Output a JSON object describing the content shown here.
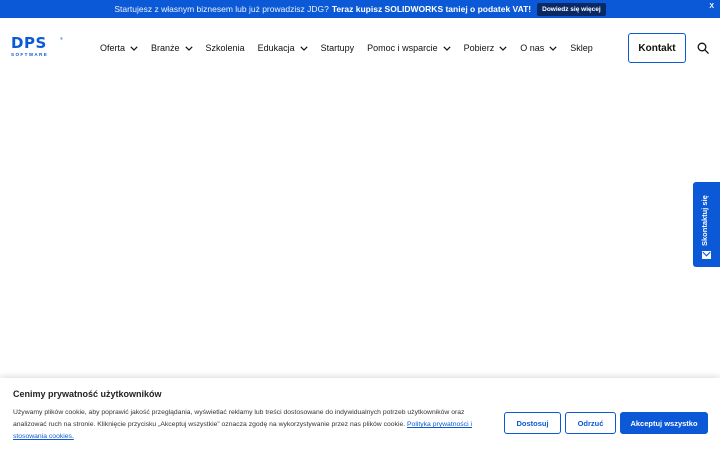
{
  "colors": {
    "brand": "#0b59d6",
    "promo_button": "#0a2a66",
    "text": "#111111"
  },
  "promo": {
    "text": "Startujesz z własnym biznesem lub już prowadzisz JDG?",
    "highlight": "Teraz kupisz SOLIDWORKS taniej o podatek VAT!",
    "button": "Dowiedz się więcej",
    "close": "X"
  },
  "logo": {
    "main": "DPS",
    "sub": "SOFTWARE",
    "reg": "®"
  },
  "nav": {
    "items": [
      {
        "label": "Oferta",
        "has_dropdown": true
      },
      {
        "label": "Branże",
        "has_dropdown": true
      },
      {
        "label": "Szkolenia",
        "has_dropdown": false
      },
      {
        "label": "Edukacja",
        "has_dropdown": true
      },
      {
        "label": "Startupy",
        "has_dropdown": false
      },
      {
        "label": "Pomoc i wsparcie",
        "has_dropdown": true
      },
      {
        "label": "Pobierz",
        "has_dropdown": true
      },
      {
        "label": "O nas",
        "has_dropdown": true
      },
      {
        "label": "Sklep",
        "has_dropdown": false
      }
    ],
    "contact": "Kontakt",
    "search_icon": "search-icon"
  },
  "side_tab": {
    "label": "Skontaktuj się",
    "icon": "mail-icon"
  },
  "cookie": {
    "title": "Cenimy prywatność użytkowników",
    "text": "Używamy plików cookie, aby poprawić jakość przeglądania, wyświetlać reklamy lub treści dostosowane do indywidualnych potrzeb użytkowników oraz analizować ruch na stronie. Kliknięcie przycisku „Akceptuj wszystkie” oznacza zgodę na wykorzystywanie przez nas plików cookie.",
    "link": "Polityka prywatności i stosowania cookies.",
    "buttons": {
      "customize": "Dostosuj",
      "reject": "Odrzuć",
      "accept_all": "Akceptuj wszystko"
    }
  }
}
